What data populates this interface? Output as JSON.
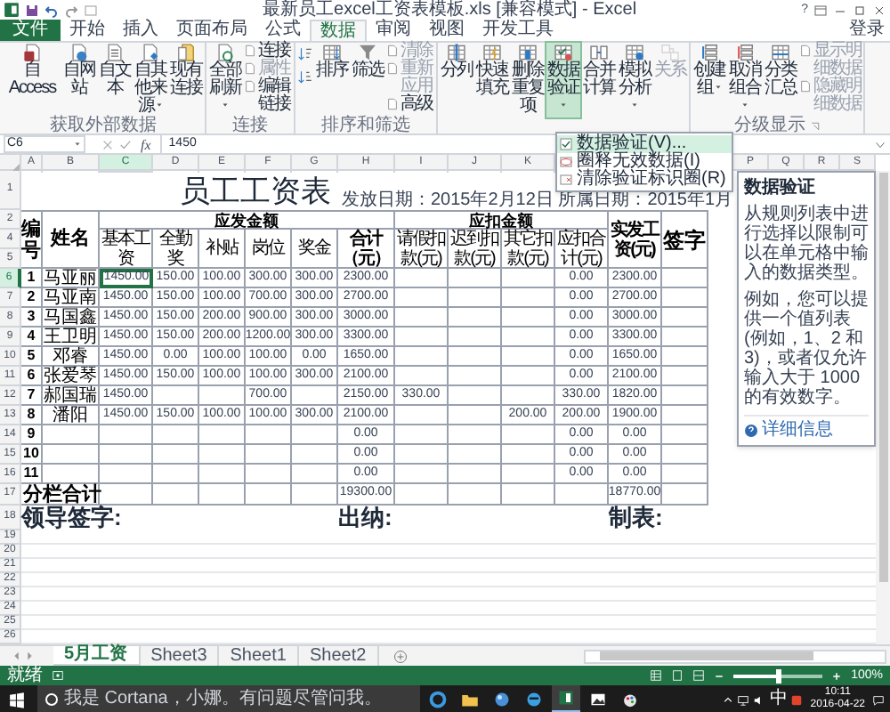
{
  "window": {
    "title": "最新员工excel工资表模板.xls  [兼容模式] - Excel",
    "help": "?"
  },
  "ribbon_tabs": [
    {
      "label": "文件",
      "kind": "file",
      "selected": false
    },
    {
      "label": "开始",
      "kind": "tab",
      "selected": false
    },
    {
      "label": "插入",
      "kind": "tab",
      "selected": false
    },
    {
      "label": "页面布局",
      "kind": "tab",
      "selected": false
    },
    {
      "label": "公式",
      "kind": "tab",
      "selected": false
    },
    {
      "label": "数据",
      "kind": "tab",
      "selected": true
    },
    {
      "label": "审阅",
      "kind": "tab",
      "selected": false
    },
    {
      "label": "视图",
      "kind": "tab",
      "selected": false
    },
    {
      "label": "开发工具",
      "kind": "tab",
      "selected": false
    }
  ],
  "account": "登录",
  "ribbon_groups": [
    {
      "label": "获取外部数据",
      "launcher": false,
      "items": [
        {
          "kind": "large",
          "label": "自 Access",
          "wide": true,
          "dropdown": false,
          "pressed": false,
          "disabled": false
        },
        {
          "kind": "large",
          "label": "自网站",
          "wide": false,
          "dropdown": false,
          "pressed": false,
          "disabled": false
        },
        {
          "kind": "large",
          "label": "自文本",
          "wide": false,
          "dropdown": false,
          "pressed": false,
          "disabled": false
        },
        {
          "kind": "large",
          "label": "自其他来源",
          "wide": false,
          "dropdown": true,
          "pressed": false,
          "disabled": false
        },
        {
          "kind": "large",
          "label": "现有连接",
          "wide": false,
          "dropdown": false,
          "pressed": false,
          "disabled": false
        }
      ]
    },
    {
      "label": "连接",
      "launcher": false,
      "items": [
        {
          "kind": "large",
          "label": "全部刷新",
          "wide": false,
          "dropdown": true,
          "pressed": false,
          "disabled": false
        },
        {
          "kind": "stack",
          "wide": false,
          "items": [
            {
              "label": "连接",
              "disabled": false
            },
            {
              "label": "属性",
              "disabled": true
            },
            {
              "label": "编辑链接",
              "disabled": false
            }
          ]
        }
      ]
    },
    {
      "label": "排序和筛选",
      "launcher": false,
      "items": [
        {
          "kind": "sort_pair"
        },
        {
          "kind": "large",
          "label": "排序",
          "wide": false,
          "dropdown": false,
          "pressed": false,
          "disabled": false
        },
        {
          "kind": "large",
          "label": "筛选",
          "wide": false,
          "dropdown": false,
          "pressed": false,
          "disabled": false
        },
        {
          "kind": "stack",
          "wide": false,
          "items": [
            {
              "label": "清除",
              "disabled": true
            },
            {
              "label": "重新应用",
              "disabled": true
            },
            {
              "label": "高级",
              "disabled": false
            }
          ]
        }
      ]
    },
    {
      "items": [
        {
          "kind": "large",
          "label": "分列",
          "wide": false,
          "dropdown": false,
          "pressed": false,
          "disabled": false
        },
        {
          "kind": "large",
          "label": "快速填充",
          "wide": false,
          "dropdown": false,
          "pressed": false,
          "disabled": false
        },
        {
          "kind": "large",
          "label": "删除重复项",
          "wide": false,
          "dropdown": false,
          "pressed": false,
          "disabled": false
        },
        {
          "kind": "large",
          "label": "数据验证",
          "wide": false,
          "dropdown": true,
          "pressed": true,
          "disabled": false
        },
        {
          "kind": "large",
          "label": "合并计算",
          "wide": false,
          "dropdown": false,
          "pressed": false,
          "disabled": false
        },
        {
          "kind": "large",
          "label": "模拟分析",
          "wide": false,
          "dropdown": true,
          "pressed": false,
          "disabled": false
        },
        {
          "kind": "large",
          "label": "关系",
          "wide": false,
          "dropdown": false,
          "pressed": false,
          "disabled": true
        }
      ]
    },
    {
      "label": "分级显示",
      "launcher": true,
      "items": [
        {
          "kind": "large",
          "label": "创建组",
          "wide": false,
          "dropdown": true,
          "pressed": false,
          "disabled": false
        },
        {
          "kind": "large",
          "label": "取消组合",
          "wide": false,
          "dropdown": true,
          "pressed": false,
          "disabled": false
        },
        {
          "kind": "large",
          "label": "分类汇总",
          "wide": false,
          "dropdown": false,
          "pressed": false,
          "disabled": false
        },
        {
          "kind": "stack",
          "wide": true,
          "items": [
            {
              "label": "显示明细数据",
              "disabled": true
            },
            {
              "label": "隐藏明细数据",
              "disabled": true
            }
          ]
        }
      ]
    }
  ],
  "formula_bar": {
    "name_box": "C6",
    "function_label": "fx",
    "formula": "1450"
  },
  "column_headers_left": [
    {
      "label": "A",
      "selected": false
    },
    {
      "label": "B",
      "selected": false
    },
    {
      "label": "C",
      "selected": true
    },
    {
      "label": "D",
      "selected": false
    },
    {
      "label": "E",
      "selected": false
    },
    {
      "label": "F",
      "selected": false
    },
    {
      "label": "G",
      "selected": false
    },
    {
      "label": "H",
      "selected": false
    },
    {
      "label": "I",
      "selected": false
    },
    {
      "label": "J",
      "selected": false
    },
    {
      "label": "K",
      "selected": false
    }
  ],
  "column_headers_right": [
    {
      "label": "P",
      "selected": false
    },
    {
      "label": "Q",
      "selected": false
    },
    {
      "label": "R",
      "selected": false
    },
    {
      "label": "S",
      "selected": false
    }
  ],
  "row_headers": [
    {
      "label": "1",
      "selected": false
    },
    {
      "label": "2",
      "selected": false
    },
    {
      "label": "4",
      "selected": false
    },
    {
      "label": "5",
      "selected": false
    },
    {
      "label": "6",
      "selected": true
    },
    {
      "label": "7",
      "selected": false
    },
    {
      "label": "8",
      "selected": false
    },
    {
      "label": "9",
      "selected": false
    },
    {
      "label": "10",
      "selected": false
    },
    {
      "label": "11",
      "selected": false
    },
    {
      "label": "12",
      "selected": false
    },
    {
      "label": "13",
      "selected": false
    },
    {
      "label": "14",
      "selected": false
    },
    {
      "label": "15",
      "selected": false
    },
    {
      "label": "16",
      "selected": false
    },
    {
      "label": "17",
      "selected": false
    },
    {
      "label": "18",
      "selected": false
    },
    {
      "label": "19",
      "selected": false
    },
    {
      "label": "20",
      "selected": false
    },
    {
      "label": "21",
      "selected": false
    },
    {
      "label": "22",
      "selected": false
    },
    {
      "label": "23",
      "selected": false
    },
    {
      "label": "24",
      "selected": false
    },
    {
      "label": "25",
      "selected": false
    },
    {
      "label": "26",
      "selected": false
    }
  ],
  "sheet": {
    "title": "员工工资表",
    "date_line": "发放日期：2015年2月12日 所属日期：2015年1月",
    "headers": {
      "number": "编号",
      "name": "姓名",
      "gross_group": "应发金额",
      "deduction_group": "应扣金额",
      "sign": "签字",
      "columns": [
        "基本工资",
        "全勤奖",
        "补贴",
        "岗位",
        "奖金",
        "合计（元）",
        "请假扣款(元)",
        "迟到扣款(元)",
        "其它扣款(元)",
        "应扣合计(元)",
        "实发工资(元)"
      ]
    },
    "rows": [
      {
        "number": "1",
        "name": "马亚丽",
        "cells": [
          "1450.00",
          "150.00",
          "100.00",
          "300.00",
          "300.00",
          "2300.00",
          null,
          null,
          null,
          "0.00",
          "2300.00"
        ]
      },
      {
        "number": "2",
        "name": "马亚南",
        "cells": [
          "1450.00",
          "150.00",
          "100.00",
          "700.00",
          "300.00",
          "2700.00",
          null,
          null,
          null,
          "0.00",
          "2700.00"
        ]
      },
      {
        "number": "3",
        "name": "马国鑫",
        "cells": [
          "1450.00",
          "150.00",
          "200.00",
          "900.00",
          "300.00",
          "3000.00",
          null,
          null,
          null,
          "0.00",
          "3000.00"
        ]
      },
      {
        "number": "4",
        "name": "王卫明",
        "cells": [
          "1450.00",
          "150.00",
          "200.00",
          "1200.00",
          "300.00",
          "3300.00",
          null,
          null,
          null,
          "0.00",
          "3300.00"
        ]
      },
      {
        "number": "5",
        "name": "邓睿",
        "cells": [
          "1450.00",
          "0.00",
          "100.00",
          "100.00",
          "0.00",
          "1650.00",
          null,
          null,
          null,
          "0.00",
          "1650.00"
        ]
      },
      {
        "number": "6",
        "name": "张爱琴",
        "cells": [
          "1450.00",
          "150.00",
          "100.00",
          "100.00",
          "300.00",
          "2100.00",
          null,
          null,
          null,
          "0.00",
          "2100.00"
        ]
      },
      {
        "number": "7",
        "name": "郝国瑞",
        "cells": [
          "1450.00",
          null,
          null,
          "700.00",
          null,
          "2150.00",
          "330.00",
          null,
          null,
          "330.00",
          "1820.00"
        ]
      },
      {
        "number": "8",
        "name": "潘阳",
        "cells": [
          "1450.00",
          "150.00",
          "100.00",
          "100.00",
          "300.00",
          "2100.00",
          null,
          null,
          "200.00",
          "200.00",
          "1900.00"
        ]
      },
      {
        "number": "9",
        "cells": [
          null,
          null,
          null,
          null,
          null,
          "0.00",
          null,
          null,
          null,
          "0.00",
          "0.00"
        ]
      },
      {
        "number": "10",
        "cells": [
          null,
          null,
          null,
          null,
          null,
          "0.00",
          null,
          null,
          null,
          "0.00",
          "0.00"
        ]
      },
      {
        "number": "11",
        "cells": [
          null,
          null,
          null,
          null,
          null,
          "0.00",
          null,
          null,
          null,
          "0.00",
          "0.00"
        ]
      }
    ],
    "total": {
      "label": "分栏合计",
      "cells": [
        null,
        null,
        null,
        null,
        null,
        "19300.00",
        null,
        null,
        null,
        null,
        "18770.00"
      ]
    },
    "signatures": [
      "领导签字:",
      "出纳:",
      "制表:"
    ]
  },
  "dropdown_menu": [
    {
      "label": "数据验证(V)...",
      "selected": true
    },
    {
      "label": "圈释无效数据(I)",
      "selected": false
    },
    {
      "label": "清除验证标识圈(R)",
      "selected": false
    }
  ],
  "tooltip": {
    "title": "数据验证",
    "paragraphs": [
      "从规则列表中进行选择以限制可以在单元格中输入的数据类型。",
      "例如，您可以提供一个值列表(例如，1、2 和 3)，或者仅允许输入大于 1000 的有效数字。"
    ],
    "link": "详细信息"
  },
  "sheet_tabs": [
    {
      "label": "5月工资",
      "selected": true
    },
    {
      "label": "Sheet3",
      "selected": false
    },
    {
      "label": "Sheet1",
      "selected": false
    },
    {
      "label": "Sheet2",
      "selected": false
    }
  ],
  "status_bar": {
    "ready": "就绪",
    "zoom": {
      "level": 0.5,
      "reading": "100%"
    }
  },
  "taskbar": {
    "search_placeholder": "我是 Cortana，小娜。有问题尽管问我。",
    "apps": [
      {
        "selected": false
      },
      {
        "selected": false
      },
      {
        "selected": false
      },
      {
        "selected": false
      },
      {
        "selected": true
      },
      {
        "selected": false
      },
      {
        "selected": false
      }
    ],
    "ime": "中",
    "time": "10:11",
    "date": "2016-04-22"
  }
}
